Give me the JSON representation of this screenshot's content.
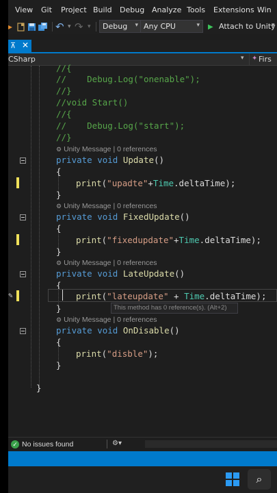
{
  "menu": [
    "View",
    "Git",
    "Project",
    "Build",
    "Debug",
    "Analyze",
    "Tools",
    "Extensions",
    "Win"
  ],
  "toolbar": {
    "config": "Debug",
    "platform": "Any CPU",
    "attach_label": "Attach to Unity",
    "attach_arrow": "▾"
  },
  "tabs": {
    "pin": "⊼",
    "close": "✕"
  },
  "nav": {
    "left": "CSharp",
    "right": "Firs"
  },
  "code": {
    "l1": "//{",
    "l2a": "//    ",
    "l2b": "Debug.Log(\"onenable\");",
    "l3": "//}",
    "l4": "//void Start()",
    "l5": "//{",
    "l6a": "//    ",
    "l6b": "Debug.Log(\"start\");",
    "l7": "//}",
    "hint": "Unity Message | 0 references",
    "kw_private": "private",
    "kw_void": "void",
    "fn_update": "Update",
    "fn_fixed": "FixedUpdate",
    "fn_late": "LateUpdate",
    "fn_disable": "OnDisable",
    "parens": "()",
    "open": "{",
    "close": "}",
    "print": "print",
    "s_upadte": "\"upadte\"",
    "s_fixed": "\"fixedupdate\"",
    "s_late": "\"lateupdate\"",
    "s_disble": "\"disble\"",
    "time": "Time",
    "delta": ".deltaTime);",
    "plus": "+",
    "plus_spaced": " + ",
    "lparen": "(",
    "endcall": ");"
  },
  "tooltip": "This method has 0 reference(s). (Alt+2)",
  "issues": {
    "text": "No issues found",
    "tool": "⚙▾"
  },
  "colors": {
    "accent": "#007acc",
    "comment": "#57a64a",
    "keyword": "#569cd6",
    "function": "#dcdcaa",
    "string": "#d69d85",
    "type": "#4ec9b0"
  },
  "icons": [
    "undo-icon",
    "redo-icon",
    "save-icon",
    "save-all-icon",
    "play-icon",
    "pin-icon",
    "close-icon",
    "lightbulb-icon",
    "check-icon",
    "windows-logo",
    "search-icon"
  ]
}
